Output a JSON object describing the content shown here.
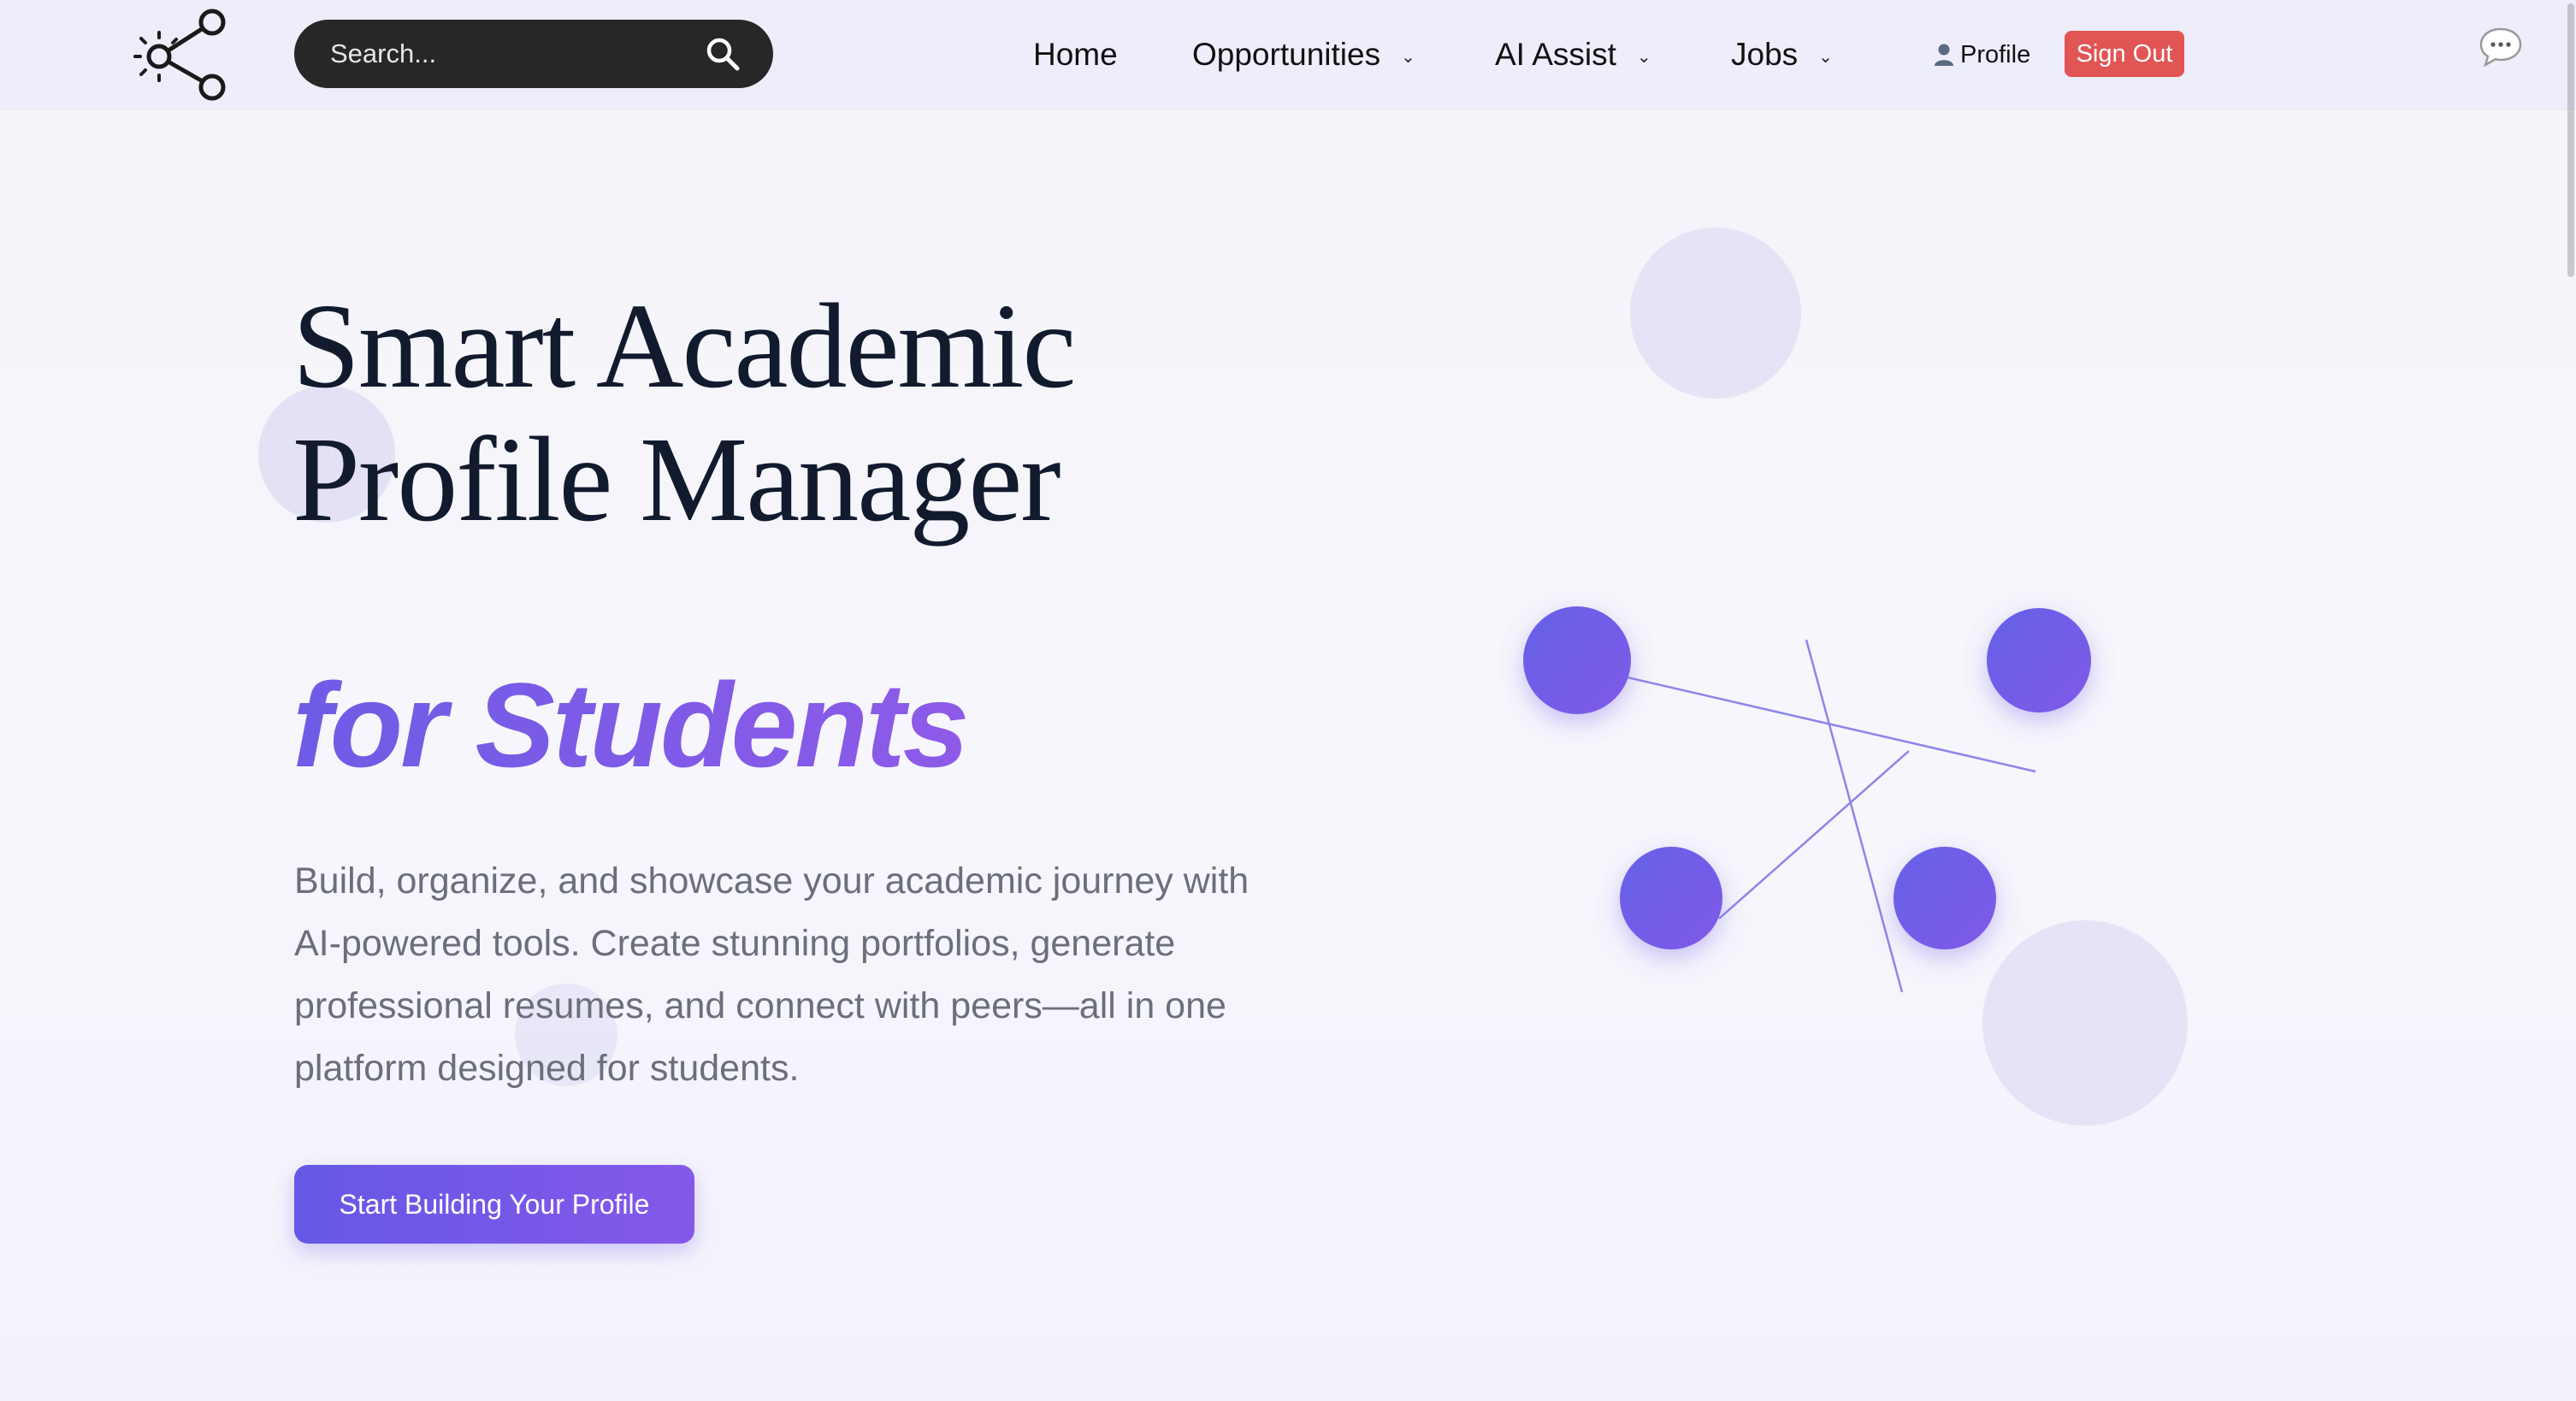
{
  "header": {
    "search": {
      "placeholder": "Search..."
    },
    "nav": [
      {
        "label": "Home",
        "has_dropdown": false
      },
      {
        "label": "Opportunities",
        "has_dropdown": true
      },
      {
        "label": "AI Assist",
        "has_dropdown": true
      },
      {
        "label": "Jobs",
        "has_dropdown": true
      }
    ],
    "profile_label": "Profile",
    "signout_label": "Sign Out",
    "icons": {
      "logo": "share-network-logo",
      "search": "search-icon",
      "profile": "person-icon",
      "chat": "chat-bubble-icon",
      "dropdown": "chevron-down-icon"
    }
  },
  "hero": {
    "title_line1": "Smart Academic",
    "title_line2": "Profile Manager",
    "title_accent": "for Students",
    "description": "Build, organize, and showcase your academic journey with AI-powered tools. Create stunning portfolios, generate professional resumes, and connect with peers—all in one platform designed for students.",
    "cta_label": "Start Building Your Profile"
  },
  "colors": {
    "accent": "#6e5ce6",
    "accent_end": "#8e5ae8",
    "signout_bg": "#e25555",
    "search_bg": "#272727",
    "navbar_bg": "#eeeefb",
    "title_text": "#121a2e",
    "body_text": "#6b6f7b"
  }
}
